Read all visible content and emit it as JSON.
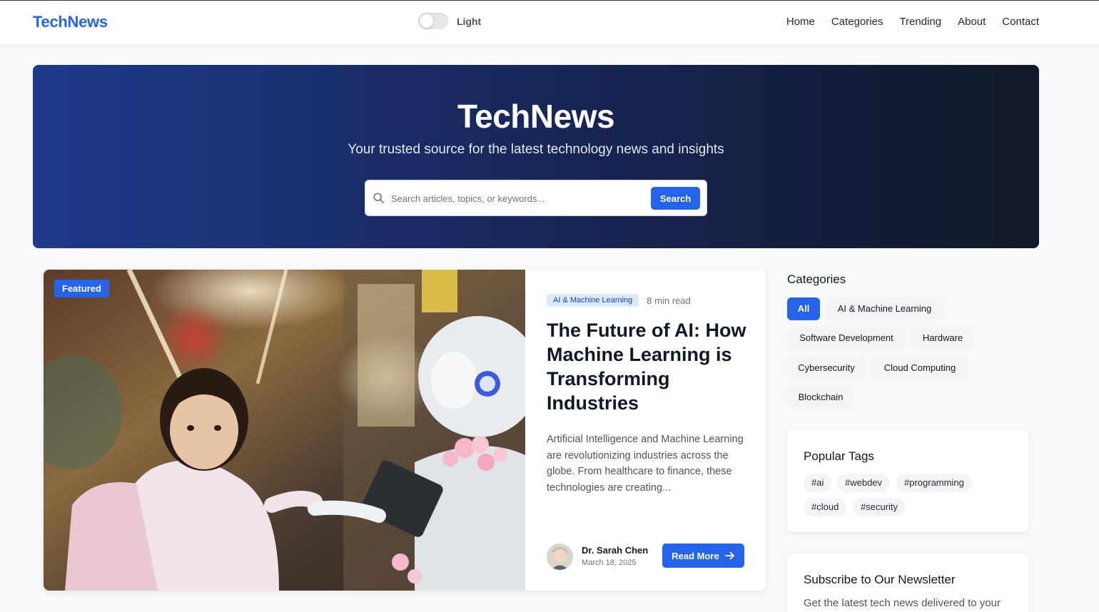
{
  "navbar": {
    "brand": "TechNews",
    "theme_label": "Light",
    "links": [
      "Home",
      "Categories",
      "Trending",
      "About",
      "Contact"
    ]
  },
  "hero": {
    "title": "TechNews",
    "subtitle": "Your trusted source for the latest technology news and insights",
    "search_placeholder": "Search articles, topics, or keywords...",
    "search_button": "Search"
  },
  "featured": {
    "badge": "Featured",
    "category": "AI & Machine Learning",
    "read_time": "8 min read",
    "title": "The Future of AI: How Machine Learning is Transforming Industries",
    "excerpt": "Artificial Intelligence and Machine Learning are revolutionizing industries across the globe. From healthcare to finance, these technologies are creating...",
    "author": "Dr. Sarah Chen",
    "date": "March 18, 2025",
    "read_more": "Read More"
  },
  "sidebar": {
    "categories_heading": "Categories",
    "categories": [
      "All",
      "AI & Machine Learning",
      "Software Development",
      "Hardware",
      "Cybersecurity",
      "Cloud Computing",
      "Blockchain"
    ],
    "active_category": "All",
    "tags_heading": "Popular Tags",
    "tags": [
      "#ai",
      "#webdev",
      "#programming",
      "#cloud",
      "#security"
    ],
    "newsletter_heading": "Subscribe to Our Newsletter",
    "newsletter_text": "Get the latest tech news delivered to your"
  },
  "colors": {
    "accent": "#2563eb",
    "hero_start": "#1e3a8a",
    "hero_end": "#111827"
  }
}
